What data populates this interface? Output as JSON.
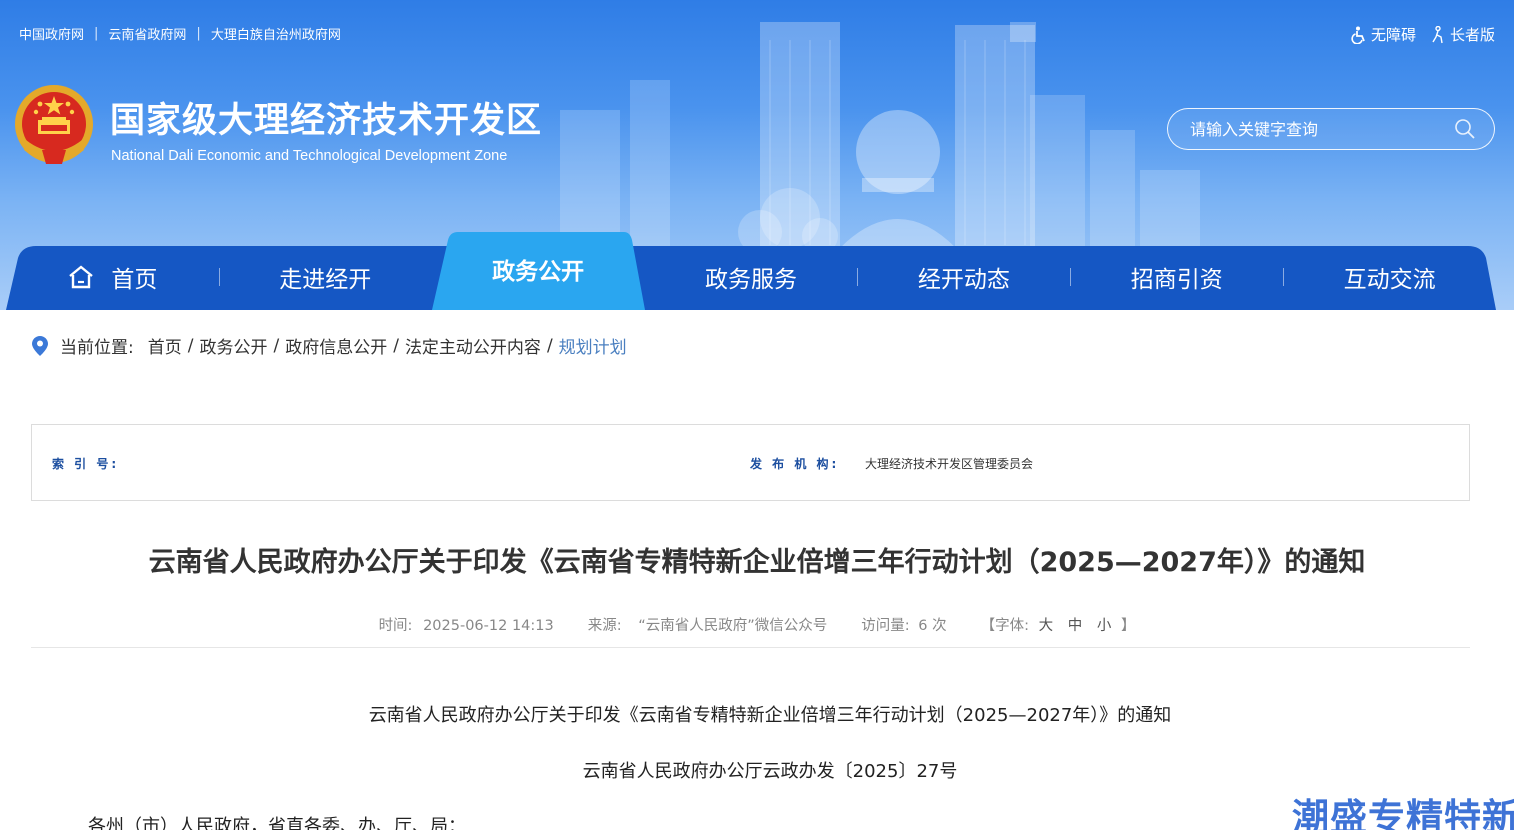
{
  "top_links": [
    "中国政府网",
    "云南省政府网",
    "大理白族自治州政府网"
  ],
  "accessibility": {
    "barrier_free": "无障碍",
    "elderly": "长者版"
  },
  "site": {
    "title": "国家级大理经济技术开发区",
    "subtitle": "National Dali Economic and Technological Development Zone"
  },
  "search": {
    "placeholder": "请输入关键字查询"
  },
  "nav": {
    "items": [
      "首页",
      "走进经开",
      "政务公开",
      "政务服务",
      "经开动态",
      "招商引资",
      "互动交流"
    ],
    "active_index": 2
  },
  "breadcrumb": {
    "label": "当前位置:",
    "items": [
      "首页",
      "政务公开",
      "政府信息公开",
      "法定主动公开内容",
      "规划计划"
    ]
  },
  "info": {
    "index_label": "索 引 号:",
    "index_value": "",
    "publisher_label": "发 布 机 构:",
    "publisher_value": "大理经济技术开发区管理委员会"
  },
  "article": {
    "title": "云南省人民政府办公厅关于印发《云南省专精特新企业倍增三年行动计划（2025—2027年）》的通知",
    "time_label": "时间:",
    "time": "2025-06-12 14:13",
    "source_label": "来源:",
    "source": "“云南省人民政府”微信公众号",
    "views_label": "访问量:",
    "views": "6 次",
    "font_label": "【字体:",
    "font_large": "大",
    "font_medium": "中",
    "font_small": "小",
    "font_close": "】",
    "body": [
      "云南省人民政府办公厅关于印发《云南省专精特新企业倍增三年行动计划（2025—2027年）》的通知",
      "云南省人民政府办公厅云政办发〔2025〕27号",
      "各州（市）人民政府，省直各委、办、厅、局："
    ]
  },
  "watermark": "潮盛专精特新",
  "colors": {
    "nav_blue": "#1557c4",
    "nav_active": "#2aa6f0",
    "link_current": "#4a7fc0",
    "label_blue": "#1d4fa0"
  }
}
